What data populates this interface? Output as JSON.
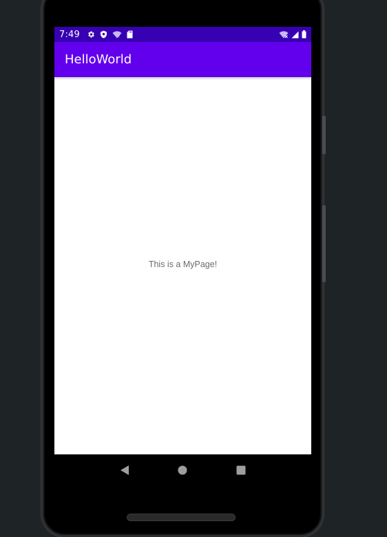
{
  "status_bar": {
    "time": "7:49",
    "left_icons": [
      "settings-icon",
      "shield-icon",
      "wifi-question-icon",
      "sd-card-icon"
    ],
    "right_icons": [
      "wifi-off-icon",
      "cell-signal-icon",
      "battery-icon"
    ],
    "background": "#3700b3"
  },
  "app_bar": {
    "title": "HelloWorld",
    "background": "#6200ee"
  },
  "content": {
    "message": "This is a MyPage!"
  },
  "nav_bar": {
    "buttons": [
      "back-icon",
      "home-icon",
      "recents-icon"
    ]
  }
}
